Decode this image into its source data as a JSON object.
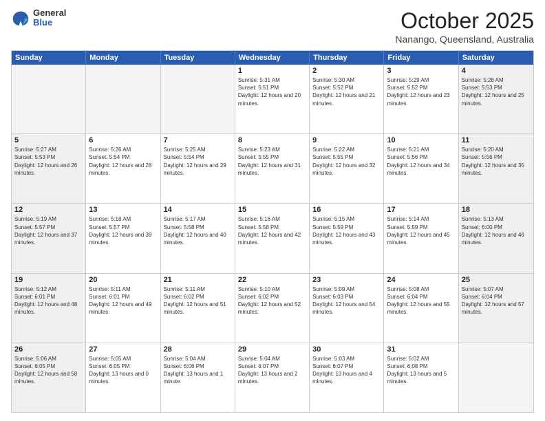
{
  "logo": {
    "general": "General",
    "blue": "Blue"
  },
  "header": {
    "month": "October 2025",
    "location": "Nanango, Queensland, Australia"
  },
  "weekdays": [
    "Sunday",
    "Monday",
    "Tuesday",
    "Wednesday",
    "Thursday",
    "Friday",
    "Saturday"
  ],
  "rows": [
    [
      {
        "day": "",
        "sunrise": "",
        "sunset": "",
        "daylight": "",
        "empty": true
      },
      {
        "day": "",
        "sunrise": "",
        "sunset": "",
        "daylight": "",
        "empty": true
      },
      {
        "day": "",
        "sunrise": "",
        "sunset": "",
        "daylight": "",
        "empty": true
      },
      {
        "day": "1",
        "sunrise": "Sunrise: 5:31 AM",
        "sunset": "Sunset: 5:51 PM",
        "daylight": "Daylight: 12 hours and 20 minutes."
      },
      {
        "day": "2",
        "sunrise": "Sunrise: 5:30 AM",
        "sunset": "Sunset: 5:52 PM",
        "daylight": "Daylight: 12 hours and 21 minutes."
      },
      {
        "day": "3",
        "sunrise": "Sunrise: 5:29 AM",
        "sunset": "Sunset: 5:52 PM",
        "daylight": "Daylight: 12 hours and 23 minutes."
      },
      {
        "day": "4",
        "sunrise": "Sunrise: 5:28 AM",
        "sunset": "Sunset: 5:53 PM",
        "daylight": "Daylight: 12 hours and 25 minutes."
      }
    ],
    [
      {
        "day": "5",
        "sunrise": "Sunrise: 5:27 AM",
        "sunset": "Sunset: 5:53 PM",
        "daylight": "Daylight: 12 hours and 26 minutes."
      },
      {
        "day": "6",
        "sunrise": "Sunrise: 5:26 AM",
        "sunset": "Sunset: 5:54 PM",
        "daylight": "Daylight: 12 hours and 28 minutes."
      },
      {
        "day": "7",
        "sunrise": "Sunrise: 5:25 AM",
        "sunset": "Sunset: 5:54 PM",
        "daylight": "Daylight: 12 hours and 29 minutes."
      },
      {
        "day": "8",
        "sunrise": "Sunrise: 5:23 AM",
        "sunset": "Sunset: 5:55 PM",
        "daylight": "Daylight: 12 hours and 31 minutes."
      },
      {
        "day": "9",
        "sunrise": "Sunrise: 5:22 AM",
        "sunset": "Sunset: 5:55 PM",
        "daylight": "Daylight: 12 hours and 32 minutes."
      },
      {
        "day": "10",
        "sunrise": "Sunrise: 5:21 AM",
        "sunset": "Sunset: 5:56 PM",
        "daylight": "Daylight: 12 hours and 34 minutes."
      },
      {
        "day": "11",
        "sunrise": "Sunrise: 5:20 AM",
        "sunset": "Sunset: 5:56 PM",
        "daylight": "Daylight: 12 hours and 35 minutes."
      }
    ],
    [
      {
        "day": "12",
        "sunrise": "Sunrise: 5:19 AM",
        "sunset": "Sunset: 5:57 PM",
        "daylight": "Daylight: 12 hours and 37 minutes."
      },
      {
        "day": "13",
        "sunrise": "Sunrise: 5:18 AM",
        "sunset": "Sunset: 5:57 PM",
        "daylight": "Daylight: 12 hours and 39 minutes."
      },
      {
        "day": "14",
        "sunrise": "Sunrise: 5:17 AM",
        "sunset": "Sunset: 5:58 PM",
        "daylight": "Daylight: 12 hours and 40 minutes."
      },
      {
        "day": "15",
        "sunrise": "Sunrise: 5:16 AM",
        "sunset": "Sunset: 5:58 PM",
        "daylight": "Daylight: 12 hours and 42 minutes."
      },
      {
        "day": "16",
        "sunrise": "Sunrise: 5:15 AM",
        "sunset": "Sunset: 5:59 PM",
        "daylight": "Daylight: 12 hours and 43 minutes."
      },
      {
        "day": "17",
        "sunrise": "Sunrise: 5:14 AM",
        "sunset": "Sunset: 5:59 PM",
        "daylight": "Daylight: 12 hours and 45 minutes."
      },
      {
        "day": "18",
        "sunrise": "Sunrise: 5:13 AM",
        "sunset": "Sunset: 6:00 PM",
        "daylight": "Daylight: 12 hours and 46 minutes."
      }
    ],
    [
      {
        "day": "19",
        "sunrise": "Sunrise: 5:12 AM",
        "sunset": "Sunset: 6:01 PM",
        "daylight": "Daylight: 12 hours and 48 minutes."
      },
      {
        "day": "20",
        "sunrise": "Sunrise: 5:11 AM",
        "sunset": "Sunset: 6:01 PM",
        "daylight": "Daylight: 12 hours and 49 minutes."
      },
      {
        "day": "21",
        "sunrise": "Sunrise: 5:11 AM",
        "sunset": "Sunset: 6:02 PM",
        "daylight": "Daylight: 12 hours and 51 minutes."
      },
      {
        "day": "22",
        "sunrise": "Sunrise: 5:10 AM",
        "sunset": "Sunset: 6:02 PM",
        "daylight": "Daylight: 12 hours and 52 minutes."
      },
      {
        "day": "23",
        "sunrise": "Sunrise: 5:09 AM",
        "sunset": "Sunset: 6:03 PM",
        "daylight": "Daylight: 12 hours and 54 minutes."
      },
      {
        "day": "24",
        "sunrise": "Sunrise: 5:08 AM",
        "sunset": "Sunset: 6:04 PM",
        "daylight": "Daylight: 12 hours and 55 minutes."
      },
      {
        "day": "25",
        "sunrise": "Sunrise: 5:07 AM",
        "sunset": "Sunset: 6:04 PM",
        "daylight": "Daylight: 12 hours and 57 minutes."
      }
    ],
    [
      {
        "day": "26",
        "sunrise": "Sunrise: 5:06 AM",
        "sunset": "Sunset: 6:05 PM",
        "daylight": "Daylight: 12 hours and 58 minutes."
      },
      {
        "day": "27",
        "sunrise": "Sunrise: 5:05 AM",
        "sunset": "Sunset: 6:05 PM",
        "daylight": "Daylight: 13 hours and 0 minutes."
      },
      {
        "day": "28",
        "sunrise": "Sunrise: 5:04 AM",
        "sunset": "Sunset: 6:06 PM",
        "daylight": "Daylight: 13 hours and 1 minute."
      },
      {
        "day": "29",
        "sunrise": "Sunrise: 5:04 AM",
        "sunset": "Sunset: 6:07 PM",
        "daylight": "Daylight: 13 hours and 2 minutes."
      },
      {
        "day": "30",
        "sunrise": "Sunrise: 5:03 AM",
        "sunset": "Sunset: 6:07 PM",
        "daylight": "Daylight: 13 hours and 4 minutes."
      },
      {
        "day": "31",
        "sunrise": "Sunrise: 5:02 AM",
        "sunset": "Sunset: 6:08 PM",
        "daylight": "Daylight: 13 hours and 5 minutes."
      },
      {
        "day": "",
        "sunrise": "",
        "sunset": "",
        "daylight": "",
        "empty": true
      }
    ]
  ]
}
